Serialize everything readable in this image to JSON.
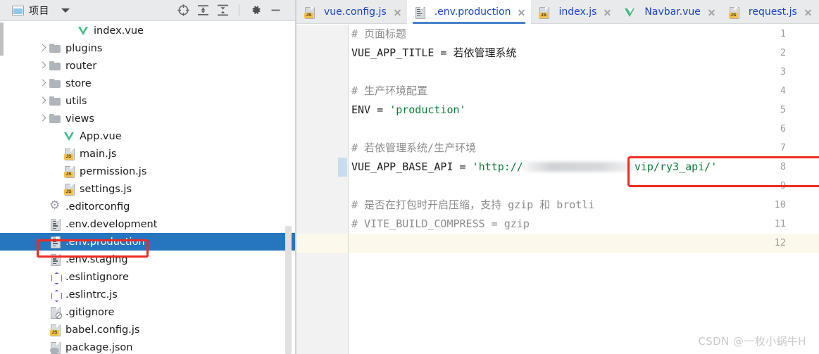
{
  "project_panel": {
    "title": "项目",
    "dropdown_icon": "chevron-down-icon",
    "toolbar_buttons": [
      {
        "name": "locate-file-icon",
        "tooltip": "Select Opened File"
      },
      {
        "name": "expand-all-icon",
        "tooltip": "Expand All"
      },
      {
        "name": "collapse-all-icon",
        "tooltip": "Collapse All"
      },
      {
        "name": "settings-gear-icon",
        "tooltip": "Settings"
      },
      {
        "name": "minimize-icon",
        "tooltip": "Hide"
      }
    ]
  },
  "file_tree": {
    "items": [
      {
        "label": "index.vue",
        "icon": "vue-file-icon",
        "indent": 4,
        "arrow": false,
        "selected": false
      },
      {
        "label": "plugins",
        "icon": "folder-icon",
        "indent": 2,
        "arrow": true,
        "selected": false
      },
      {
        "label": "router",
        "icon": "folder-icon",
        "indent": 2,
        "arrow": true,
        "selected": false
      },
      {
        "label": "store",
        "icon": "folder-icon",
        "indent": 2,
        "arrow": true,
        "selected": false
      },
      {
        "label": "utils",
        "icon": "folder-icon",
        "indent": 2,
        "arrow": true,
        "selected": false
      },
      {
        "label": "views",
        "icon": "folder-icon",
        "indent": 2,
        "arrow": true,
        "selected": false
      },
      {
        "label": "App.vue",
        "icon": "vue-file-icon",
        "indent": 3,
        "arrow": false,
        "selected": false
      },
      {
        "label": "main.js",
        "icon": "js-file-icon",
        "indent": 3,
        "arrow": false,
        "selected": false
      },
      {
        "label": "permission.js",
        "icon": "js-file-icon",
        "indent": 3,
        "arrow": false,
        "selected": false
      },
      {
        "label": "settings.js",
        "icon": "js-file-icon",
        "indent": 3,
        "arrow": false,
        "selected": false
      },
      {
        "label": ".editorconfig",
        "icon": "config-gear-icon",
        "indent": 2,
        "arrow": false,
        "selected": false
      },
      {
        "label": ".env.development",
        "icon": "text-file-icon",
        "indent": 2,
        "arrow": false,
        "selected": false
      },
      {
        "label": ".env.production",
        "icon": "text-file-icon",
        "indent": 2,
        "arrow": false,
        "selected": true
      },
      {
        "label": ".env.staging",
        "icon": "text-file-icon",
        "indent": 2,
        "arrow": false,
        "selected": false
      },
      {
        "label": ".eslintignore",
        "icon": "eslint-icon",
        "indent": 2,
        "arrow": false,
        "selected": false
      },
      {
        "label": ".eslintrc.js",
        "icon": "eslint-icon",
        "indent": 2,
        "arrow": false,
        "selected": false
      },
      {
        "label": ".gitignore",
        "icon": "gitignore-icon",
        "indent": 2,
        "arrow": false,
        "selected": false
      },
      {
        "label": "babel.config.js",
        "icon": "js-file-icon",
        "indent": 2,
        "arrow": false,
        "selected": false
      },
      {
        "label": "package.json",
        "icon": "json-file-icon",
        "indent": 2,
        "arrow": false,
        "selected": false
      }
    ]
  },
  "tabs": [
    {
      "label": "vue.config.js",
      "icon": "js-file-icon",
      "active": false
    },
    {
      "label": ".env.production",
      "icon": "text-file-icon",
      "active": true
    },
    {
      "label": "index.js",
      "icon": "js-file-icon",
      "active": false
    },
    {
      "label": "Navbar.vue",
      "icon": "vue-file-icon",
      "active": false
    },
    {
      "label": "request.js",
      "icon": "js-file-icon",
      "active": false
    }
  ],
  "editor": {
    "line_numbers": [
      "1",
      "2",
      "3",
      "4",
      "5",
      "6",
      "7",
      "8",
      "9",
      "10",
      "11",
      "12"
    ],
    "lines": [
      {
        "n": 1,
        "segments": [
          {
            "text": "# 页面标题",
            "style": "comment"
          }
        ]
      },
      {
        "n": 2,
        "segments": [
          {
            "text": "VUE_APP_TITLE = 若依管理系统",
            "style": "plain"
          }
        ]
      },
      {
        "n": 3,
        "segments": [
          {
            "text": "",
            "style": "plain"
          }
        ]
      },
      {
        "n": 4,
        "segments": [
          {
            "text": "# 生产环境配置",
            "style": "comment"
          }
        ]
      },
      {
        "n": 5,
        "segments": [
          {
            "text": "ENV = ",
            "style": "plain"
          },
          {
            "text": "'production'",
            "style": "string"
          }
        ]
      },
      {
        "n": 6,
        "segments": [
          {
            "text": "",
            "style": "plain"
          }
        ]
      },
      {
        "n": 7,
        "segments": [
          {
            "text": "# 若依管理系统/生产环境",
            "style": "comment"
          }
        ]
      },
      {
        "n": 8,
        "segments": [
          {
            "text": "VUE_APP_BASE_API = ",
            "style": "plain"
          },
          {
            "text": "'http://",
            "style": "string"
          },
          {
            "text": "[redacted]",
            "style": "redacted"
          },
          {
            "text": "vip/ry3_api/'",
            "style": "string"
          }
        ]
      },
      {
        "n": 9,
        "segments": [
          {
            "text": "",
            "style": "plain"
          }
        ]
      },
      {
        "n": 10,
        "segments": [
          {
            "text": "# 是否在打包时开启压缩，支持 gzip 和 brotli",
            "style": "comment"
          }
        ]
      },
      {
        "n": 11,
        "segments": [
          {
            "text": "# VITE_BUILD_COMPRESS = gzip",
            "style": "comment"
          }
        ]
      },
      {
        "n": 12,
        "segments": [
          {
            "text": "",
            "style": "plain"
          }
        ]
      }
    ],
    "caret_line": 12,
    "changed_line": 8
  },
  "annotations": [
    {
      "name": "sidebar-highlight-box",
      "target": ".env.production",
      "color": "#ef2a22"
    },
    {
      "name": "code-highlight-box",
      "target": "VUE_APP_BASE_API line",
      "color": "#ef2a22"
    }
  ],
  "watermark": {
    "text": "CSDN @一枚小蜗牛H"
  },
  "colors": {
    "selection_blue": "#2675bf",
    "annotation_red": "#ef2a22",
    "tab_text_blue": "#1b46c2",
    "caret_line_yellow": "#fcf9ec",
    "toolbar_gray": "#e8eaec",
    "vue_green": "#41b883",
    "js_yellow": "#f4c04e"
  }
}
